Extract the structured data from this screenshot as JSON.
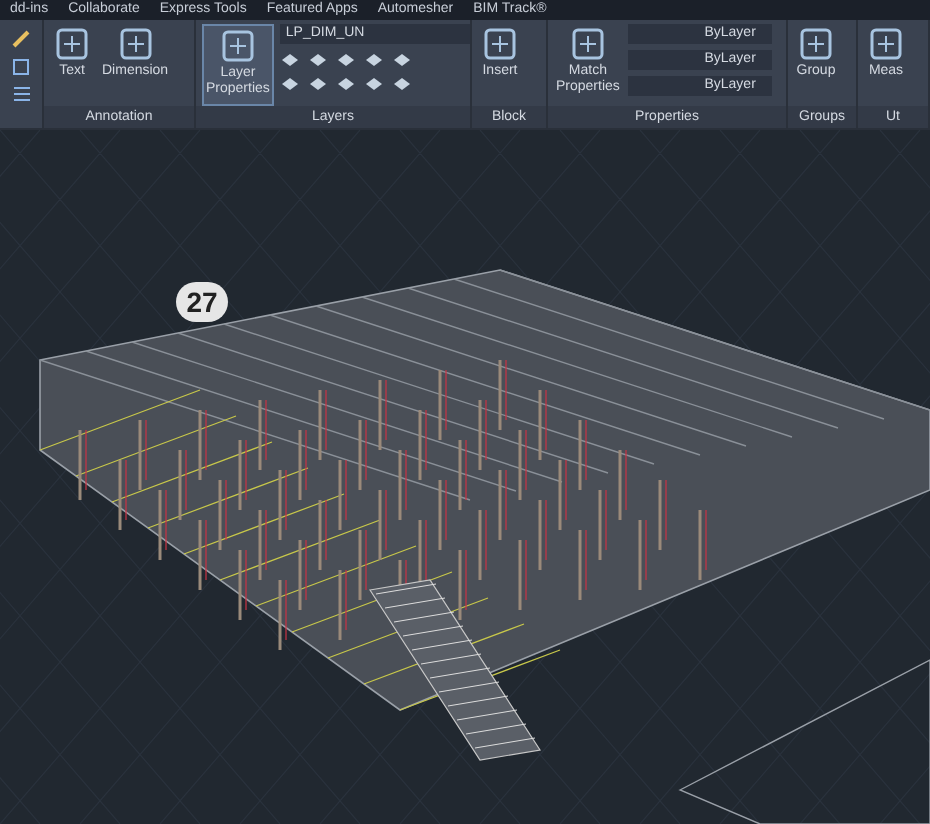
{
  "ribbon_tabs": [
    {
      "label": "dd-ins",
      "selected": false
    },
    {
      "label": "Collaborate",
      "selected": false
    },
    {
      "label": "Express Tools",
      "selected": false
    },
    {
      "label": "Featured Apps",
      "selected": false
    },
    {
      "label": "Automesher",
      "selected": false
    },
    {
      "label": "BIM Track®",
      "selected": false
    }
  ],
  "panels": [
    {
      "title": "Annotation",
      "buttons": [
        "Text",
        "Dimension"
      ]
    },
    {
      "title": "Layers",
      "buttons": [
        "Layer\nProperties"
      ],
      "layer": "LP_DIM_UN"
    },
    {
      "title": "Block",
      "buttons": [
        "Insert"
      ]
    },
    {
      "title": "Properties",
      "buttons": [
        "Match\nProperties"
      ],
      "dropdowns": [
        "ByLayer",
        "ByLayer",
        "ByLayer"
      ]
    },
    {
      "title": "Groups",
      "buttons": [
        "Group"
      ]
    },
    {
      "title": "Ut",
      "buttons": [
        "Meas"
      ]
    }
  ],
  "canvas": {
    "callout": "27"
  }
}
